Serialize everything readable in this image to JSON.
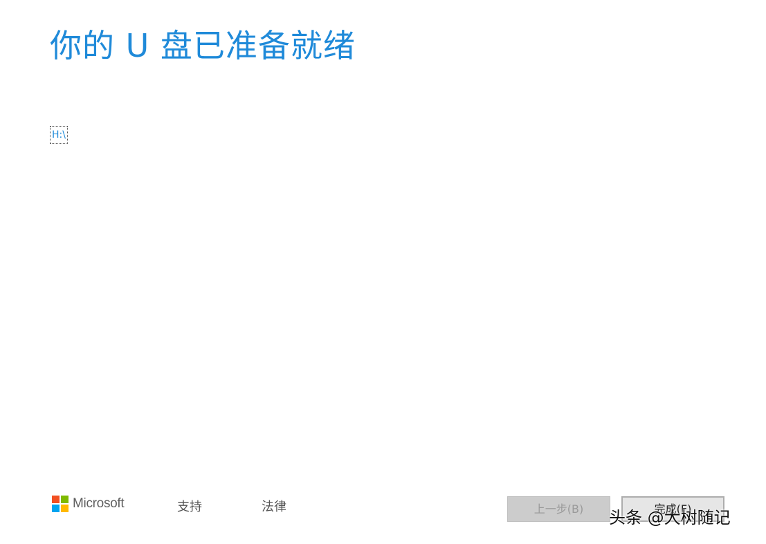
{
  "page": {
    "title": "你的 U 盘已准备就绪"
  },
  "drive": {
    "label": "H:\\"
  },
  "footer": {
    "logo_text": "Microsoft",
    "logo_colors": [
      "#f25022",
      "#7fba00",
      "#00a4ef",
      "#ffb900"
    ],
    "links": {
      "support": "支持",
      "legal": "法律"
    }
  },
  "buttons": {
    "back_label": "上一步(B)",
    "finish_label": "完成(F)"
  },
  "watermark": {
    "text": "头条 @大树随记"
  },
  "colors": {
    "accent": "#1f8ad9"
  }
}
